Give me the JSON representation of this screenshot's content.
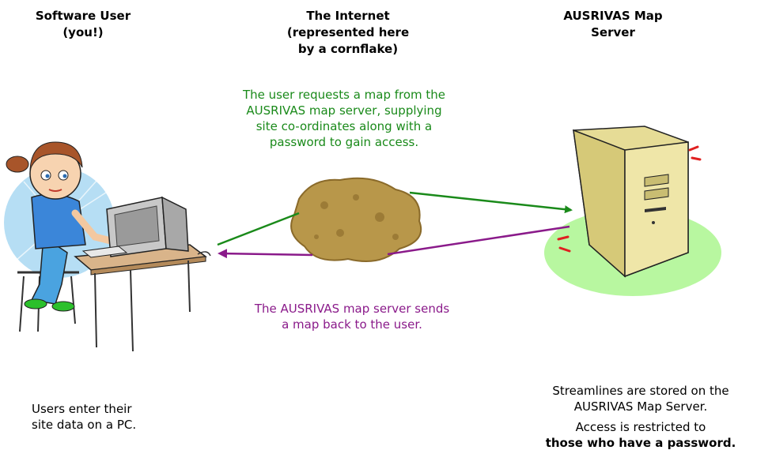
{
  "headings": {
    "user": [
      "Software User",
      "(you!)"
    ],
    "internet": [
      "The Internet",
      "(represented here",
      "by a cornflake)"
    ],
    "server": [
      "AUSRIVAS Map",
      "Server"
    ]
  },
  "notes": {
    "request": [
      "The user requests a map from the",
      "AUSRIVAS map server, supplying",
      "site co-ordinates along with a",
      "password to gain access."
    ],
    "response": [
      "The AUSRIVAS map server sends",
      "a map back to the user."
    ],
    "user_caption": [
      "Users enter their",
      "site data on a PC."
    ],
    "server_caption_1": [
      "Streamlines are stored on the",
      "AUSRIVAS Map Server."
    ],
    "server_caption_2a": "Access is restricted to",
    "server_caption_2b": "those who have a password."
  },
  "colors": {
    "request_arrow": "#1a8a1a",
    "response_arrow": "#8a1a8a",
    "server_glow": "#b8f7a0",
    "cornflake": "#b8974a"
  }
}
